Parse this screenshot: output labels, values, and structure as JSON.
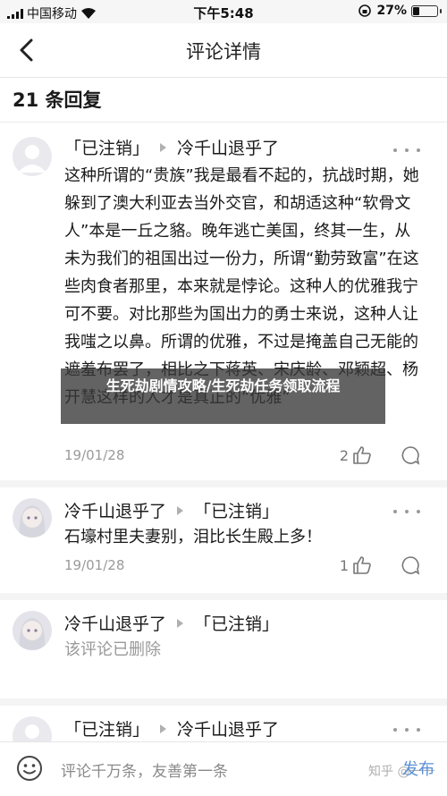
{
  "status": {
    "carrier": "中国移动",
    "time": "下午5:48",
    "battery": "27%",
    "battery_level": 0.27
  },
  "nav": {
    "title": "评论详情"
  },
  "reply_count": "21 条回复",
  "comments": [
    {
      "author": "「已注销」",
      "reply_to": "冷千山退乎了",
      "text": "这种所谓的“贵族”我是最看不起的，抗战时期，她躲到了澳大利亚去当外交官，和胡适这种“软骨文人”本是一丘之貉。晚年逃亡美国，终其一生，从未为我们的祖国出过一份力，所谓“勤劳致富”在这些肉食者那里，本来就是悖论。这种人的优雅我宁可不要。对比那些为国出力的勇士来说，这种人让我嗤之以鼻。所谓的优雅，不过是掩盖自己无能的遮羞布罢了，相比之下蒋英、宋庆龄、邓颖超、杨开慧这样的人才是真正的“优雅”",
      "date": "19/01/28",
      "likes": "2"
    },
    {
      "author": "冷千山退乎了",
      "reply_to": "「已注销」",
      "text": "石壕村里夫妻别，泪比长生殿上多！",
      "date": "19/01/28",
      "likes": "1"
    },
    {
      "author": "冷千山退乎了",
      "reply_to": "「已注销」",
      "text": "该评论已删除",
      "date": "",
      "likes": ""
    },
    {
      "author": "「已注销」",
      "reply_to": "冷千山退乎了",
      "text": "",
      "date": "",
      "likes": ""
    }
  ],
  "overlay": {
    "text": "生死劫剧情攻略/生死劫任务领取流程"
  },
  "bottom": {
    "placeholder": "评论千万条，友善第一条",
    "send": "发布",
    "watermark": "知乎 @一一"
  }
}
